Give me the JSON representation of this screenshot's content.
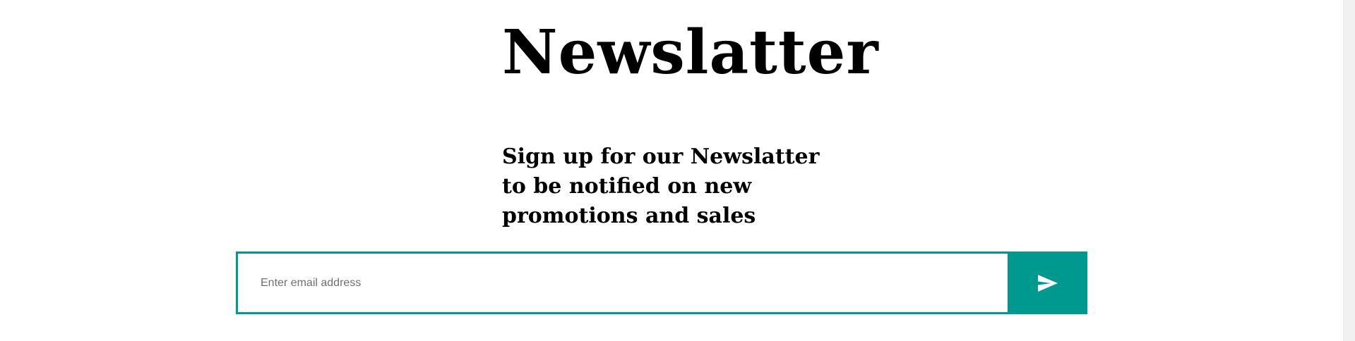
{
  "newsletter": {
    "title": "Newslatter",
    "subtitle": "Sign up for our Newslatter to be notified on new promotions and sales",
    "email_placeholder": "Enter email address",
    "submit_icon": "send-icon"
  },
  "colors": {
    "accent": "#009990",
    "text": "#000000",
    "background": "#ffffff"
  }
}
